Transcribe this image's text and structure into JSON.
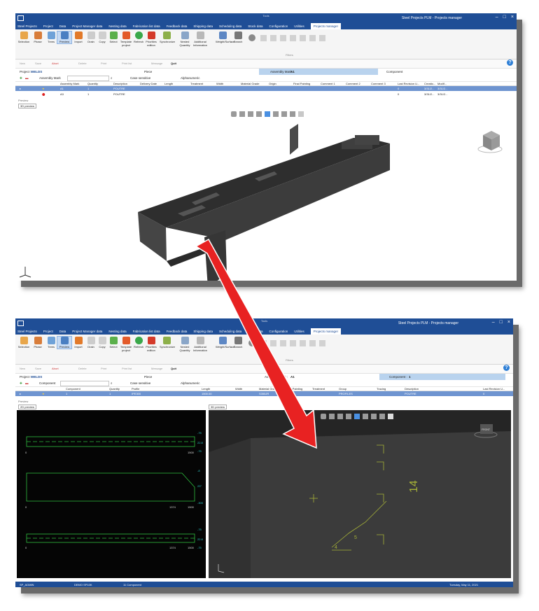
{
  "app": {
    "title": "Steel Projects PLM - Projects manager",
    "center_label": "Tools"
  },
  "menu": [
    "Steel Projects",
    "Project",
    "Data",
    "Project Manager data",
    "Nesting data",
    "Fabrication list data",
    "Feedback data",
    "Shipping data",
    "Scheduling data",
    "Stock data",
    "Configuration",
    "Utilities",
    "Projects manager"
  ],
  "ribbon1": [
    "Selection",
    "Phase",
    "Trees",
    "Preview",
    "Import",
    "Drain",
    "Copy",
    "Select",
    "Template project",
    "Refresh",
    "Priorities edition",
    "Synchronize",
    "Nested Quantity",
    "Additional Information",
    "Weight/Surface",
    "Search"
  ],
  "ribbon2": [
    "Selection",
    "Phase",
    "Trees",
    "Preview",
    "Import",
    "Drain",
    "Copy",
    "Select",
    "Template project",
    "Refresh",
    "Priorities edition",
    "Synchronize",
    "Nested Quantity",
    "Additional Information",
    "Weight/Surface",
    "Search"
  ],
  "filters_label": "Filters",
  "toolbar": {
    "new": "New",
    "save": "Save",
    "abort": "Abort",
    "delete": "Delete",
    "print": "Print",
    "print_list": "Print list",
    "message": "Message",
    "quit": "Quit"
  },
  "ctx1": {
    "project_label": "Project :",
    "project": "WELDS",
    "piece": "Piece",
    "assembly_label": "Assembly Mark :",
    "assembly": "A1",
    "component": "Component"
  },
  "ctx2": {
    "project_label": "Project :",
    "project": "WELDS",
    "piece": "Piece",
    "assembly_label": "Assembly Mark :",
    "assembly": "A1",
    "component_label": "Component :",
    "component": "1"
  },
  "filter1": {
    "field": "Assembly Mark",
    "case": "Case sensitive",
    "alpha": "Alphanumeric"
  },
  "filter2": {
    "field": "Component",
    "case": "Case sensitive",
    "alpha": "Alphanumeric"
  },
  "grid1": {
    "headers": [
      "Assembly Mark",
      "Quantity",
      "Description",
      "Delivery Date",
      "Length",
      "Treatment",
      "Width",
      "Material Grade",
      "Origin",
      "Final Painting",
      "Comment 1",
      "Comment 2",
      "Comment 3",
      "Last Revision U...",
      "Creatio...",
      "Modif..."
    ],
    "rows": [
      [
        "A1",
        "1",
        "POUTRE",
        "",
        "",
        "",
        "",
        "",
        "",
        "",
        "",
        "",
        "",
        "0",
        "3/31/2...",
        "3/31/2..."
      ],
      [
        "A3",
        "1",
        "POUTRE",
        "",
        "",
        "",
        "",
        "",
        "",
        "",
        "",
        "",
        "",
        "0",
        "3/31/2...",
        "3/31/2..."
      ]
    ]
  },
  "grid2": {
    "headers": [
      "Component",
      "Quantity",
      "Profile",
      "Length",
      "Width",
      "Material Grade",
      "Final Painting",
      "Treatment",
      "Group",
      "Tracing",
      "Description",
      "Last Revision U..."
    ],
    "row": [
      "1",
      "1",
      "IPE300",
      "1500.00",
      "",
      "S355JR",
      "",
      "",
      "PROFILES",
      "",
      "POUTRE",
      "0"
    ]
  },
  "preview_label": "Preview",
  "tab_3d": "3D preview",
  "tab_2d": "2D preview",
  "view_cube_label": "FRONT",
  "drawing": {
    "dims_top": [
      "-75",
      "22.8",
      "-75"
    ],
    "dims_mid": [
      "-8",
      "23°",
      "-300"
    ],
    "dims_bot": [
      "-75",
      "22.8",
      "-75"
    ],
    "x_top": [
      "0",
      "1500"
    ],
    "x_mid": [
      "0",
      "1374",
      "1500"
    ],
    "x_bot": [
      "0",
      "1374",
      "1500"
    ]
  },
  "weld_text": "14",
  "weld_numbers": [
    "4",
    "5"
  ],
  "status": {
    "user": "SP_ADMIN",
    "db": "DEMO SP10K",
    "count": "11 Component",
    "date": "Tuesday, May 11, 2021"
  },
  "colors": {
    "titlebar": "#1f4e96",
    "selected_row": "#6e94d0",
    "arrow": "#e82222",
    "steel": "#3b3b3b",
    "dim_green": "#2fbf3f",
    "weld_yellow": "#a7b337"
  }
}
